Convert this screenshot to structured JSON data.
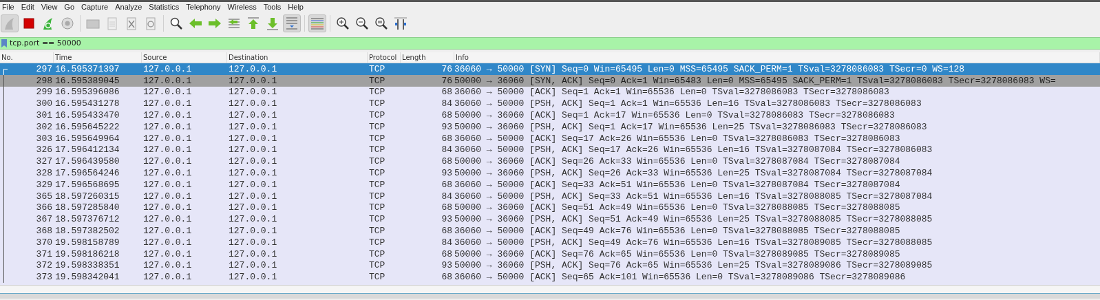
{
  "menu": [
    "File",
    "Edit",
    "View",
    "Go",
    "Capture",
    "Analyze",
    "Statistics",
    "Telephony",
    "Wireless",
    "Tools",
    "Help"
  ],
  "toolbar": [
    {
      "kind": "shark",
      "pressed": true
    },
    {
      "kind": "stop",
      "pressed": false
    },
    {
      "kind": "restart",
      "pressed": false
    },
    {
      "kind": "options",
      "pressed": false
    },
    {
      "kind": "sep"
    },
    {
      "kind": "open",
      "pressed": false
    },
    {
      "kind": "save",
      "pressed": false
    },
    {
      "kind": "close",
      "pressed": false
    },
    {
      "kind": "reload",
      "pressed": false
    },
    {
      "kind": "sep"
    },
    {
      "kind": "find",
      "pressed": false
    },
    {
      "kind": "back",
      "pressed": false
    },
    {
      "kind": "forward",
      "pressed": false
    },
    {
      "kind": "goto",
      "pressed": false
    },
    {
      "kind": "first",
      "pressed": false
    },
    {
      "kind": "last",
      "pressed": false
    },
    {
      "kind": "autoscroll",
      "pressed": true
    },
    {
      "kind": "sep"
    },
    {
      "kind": "colorize",
      "pressed": true
    },
    {
      "kind": "sep"
    },
    {
      "kind": "zoomin",
      "pressed": false
    },
    {
      "kind": "zoomout",
      "pressed": false
    },
    {
      "kind": "zoomreset",
      "pressed": false
    },
    {
      "kind": "resize",
      "pressed": false
    }
  ],
  "filter": {
    "value": "tcp.port == 50000"
  },
  "table": {
    "columns": [
      "No.",
      "Time",
      "Source",
      "Destination",
      "Protocol",
      "Length",
      "Info"
    ],
    "rows": [
      {
        "no": "297",
        "time": "16.595371397",
        "source": "127.0.0.1",
        "destination": "127.0.0.1",
        "protocol": "TCP",
        "length": "76",
        "info": "36060 → 50000 [SYN] Seq=0 Win=65495 Len=0 MSS=65495 SACK_PERM=1 TSval=3278086083 TSecr=0 WS=128",
        "selected": true,
        "hovered": false
      },
      {
        "no": "298",
        "time": "16.595389045",
        "source": "127.0.0.1",
        "destination": "127.0.0.1",
        "protocol": "TCP",
        "length": "76",
        "info": "50000 → 36060 [SYN, ACK] Seq=0 Ack=1 Win=65483 Len=0 MSS=65495 SACK_PERM=1 TSval=3278086083 TSecr=3278086083 WS=",
        "selected": false,
        "hovered": true
      },
      {
        "no": "299",
        "time": "16.595396086",
        "source": "127.0.0.1",
        "destination": "127.0.0.1",
        "protocol": "TCP",
        "length": "68",
        "info": "36060 → 50000 [ACK] Seq=1 Ack=1 Win=65536 Len=0 TSval=3278086083 TSecr=3278086083",
        "selected": false,
        "hovered": false
      },
      {
        "no": "300",
        "time": "16.595431278",
        "source": "127.0.0.1",
        "destination": "127.0.0.1",
        "protocol": "TCP",
        "length": "84",
        "info": "36060 → 50000 [PSH, ACK] Seq=1 Ack=1 Win=65536 Len=16 TSval=3278086083 TSecr=3278086083",
        "selected": false,
        "hovered": false
      },
      {
        "no": "301",
        "time": "16.595433470",
        "source": "127.0.0.1",
        "destination": "127.0.0.1",
        "protocol": "TCP",
        "length": "68",
        "info": "50000 → 36060 [ACK] Seq=1 Ack=17 Win=65536 Len=0 TSval=3278086083 TSecr=3278086083",
        "selected": false,
        "hovered": false
      },
      {
        "no": "302",
        "time": "16.595645222",
        "source": "127.0.0.1",
        "destination": "127.0.0.1",
        "protocol": "TCP",
        "length": "93",
        "info": "50000 → 36060 [PSH, ACK] Seq=1 Ack=17 Win=65536 Len=25 TSval=3278086083 TSecr=3278086083",
        "selected": false,
        "hovered": false
      },
      {
        "no": "303",
        "time": "16.595649964",
        "source": "127.0.0.1",
        "destination": "127.0.0.1",
        "protocol": "TCP",
        "length": "68",
        "info": "36060 → 50000 [ACK] Seq=17 Ack=26 Win=65536 Len=0 TSval=3278086083 TSecr=3278086083",
        "selected": false,
        "hovered": false
      },
      {
        "no": "326",
        "time": "17.596412134",
        "source": "127.0.0.1",
        "destination": "127.0.0.1",
        "protocol": "TCP",
        "length": "84",
        "info": "36060 → 50000 [PSH, ACK] Seq=17 Ack=26 Win=65536 Len=16 TSval=3278087084 TSecr=3278086083",
        "selected": false,
        "hovered": false
      },
      {
        "no": "327",
        "time": "17.596439580",
        "source": "127.0.0.1",
        "destination": "127.0.0.1",
        "protocol": "TCP",
        "length": "68",
        "info": "50000 → 36060 [ACK] Seq=26 Ack=33 Win=65536 Len=0 TSval=3278087084 TSecr=3278087084",
        "selected": false,
        "hovered": false
      },
      {
        "no": "328",
        "time": "17.596564246",
        "source": "127.0.0.1",
        "destination": "127.0.0.1",
        "protocol": "TCP",
        "length": "93",
        "info": "50000 → 36060 [PSH, ACK] Seq=26 Ack=33 Win=65536 Len=25 TSval=3278087084 TSecr=3278087084",
        "selected": false,
        "hovered": false
      },
      {
        "no": "329",
        "time": "17.596568695",
        "source": "127.0.0.1",
        "destination": "127.0.0.1",
        "protocol": "TCP",
        "length": "68",
        "info": "36060 → 50000 [ACK] Seq=33 Ack=51 Win=65536 Len=0 TSval=3278087084 TSecr=3278087084",
        "selected": false,
        "hovered": false
      },
      {
        "no": "365",
        "time": "18.597260315",
        "source": "127.0.0.1",
        "destination": "127.0.0.1",
        "protocol": "TCP",
        "length": "84",
        "info": "36060 → 50000 [PSH, ACK] Seq=33 Ack=51 Win=65536 Len=16 TSval=3278088085 TSecr=3278087084",
        "selected": false,
        "hovered": false
      },
      {
        "no": "366",
        "time": "18.597285840",
        "source": "127.0.0.1",
        "destination": "127.0.0.1",
        "protocol": "TCP",
        "length": "68",
        "info": "50000 → 36060 [ACK] Seq=51 Ack=49 Win=65536 Len=0 TSval=3278088085 TSecr=3278088085",
        "selected": false,
        "hovered": false
      },
      {
        "no": "367",
        "time": "18.597376712",
        "source": "127.0.0.1",
        "destination": "127.0.0.1",
        "protocol": "TCP",
        "length": "93",
        "info": "50000 → 36060 [PSH, ACK] Seq=51 Ack=49 Win=65536 Len=25 TSval=3278088085 TSecr=3278088085",
        "selected": false,
        "hovered": false
      },
      {
        "no": "368",
        "time": "18.597382502",
        "source": "127.0.0.1",
        "destination": "127.0.0.1",
        "protocol": "TCP",
        "length": "68",
        "info": "36060 → 50000 [ACK] Seq=49 Ack=76 Win=65536 Len=0 TSval=3278088085 TSecr=3278088085",
        "selected": false,
        "hovered": false
      },
      {
        "no": "370",
        "time": "19.598158789",
        "source": "127.0.0.1",
        "destination": "127.0.0.1",
        "protocol": "TCP",
        "length": "84",
        "info": "36060 → 50000 [PSH, ACK] Seq=49 Ack=76 Win=65536 Len=16 TSval=3278089085 TSecr=3278088085",
        "selected": false,
        "hovered": false
      },
      {
        "no": "371",
        "time": "19.598186218",
        "source": "127.0.0.1",
        "destination": "127.0.0.1",
        "protocol": "TCP",
        "length": "68",
        "info": "50000 → 36060 [ACK] Seq=76 Ack=65 Win=65536 Len=0 TSval=3278089085 TSecr=3278089085",
        "selected": false,
        "hovered": false
      },
      {
        "no": "372",
        "time": "19.598338351",
        "source": "127.0.0.1",
        "destination": "127.0.0.1",
        "protocol": "TCP",
        "length": "93",
        "info": "50000 → 36060 [PSH, ACK] Seq=76 Ack=65 Win=65536 Len=25 TSval=3278089086 TSecr=3278089085",
        "selected": false,
        "hovered": false
      },
      {
        "no": "373",
        "time": "19.598342041",
        "source": "127.0.0.1",
        "destination": "127.0.0.1",
        "protocol": "TCP",
        "length": "68",
        "info": "36060 → 50000 [ACK] Seq=65 Ack=101 Win=65536 Len=0 TSval=3278089086 TSecr=3278089086",
        "selected": false,
        "hovered": false
      }
    ]
  }
}
